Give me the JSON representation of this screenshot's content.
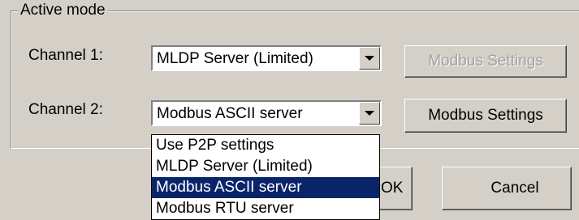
{
  "group": {
    "title": "Active mode"
  },
  "channel1": {
    "label": "Channel 1:",
    "value": "MLDP Server (Limited)",
    "settings_label": "Modbus Settings",
    "settings_enabled": false
  },
  "channel2": {
    "label": "Channel 2:",
    "value": "Modbus ASCII server",
    "settings_label": "Modbus Settings",
    "settings_enabled": true
  },
  "dropdown": {
    "open": true,
    "items": [
      {
        "label": "Use P2P settings",
        "selected": false
      },
      {
        "label": "MLDP Server (Limited)",
        "selected": false
      },
      {
        "label": "Modbus ASCII server",
        "selected": true
      },
      {
        "label": "Modbus RTU server",
        "selected": false
      }
    ]
  },
  "footer": {
    "ok_label": "OK",
    "cancel_label": "Cancel"
  },
  "colors": {
    "face": "#d4d0c8",
    "highlight": "#0a246a",
    "disabled_text": "#a0a0a0"
  }
}
